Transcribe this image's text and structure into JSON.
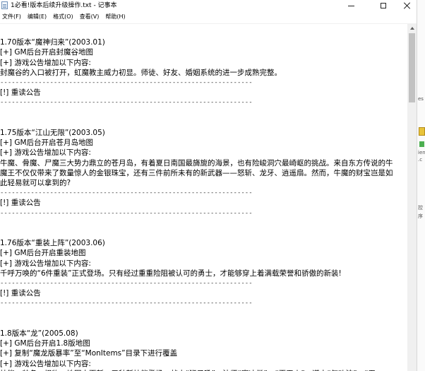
{
  "window": {
    "title": "1必看!版本后续升级操作.txt - 记事本"
  },
  "menu": [
    "文件(F)",
    "编辑(E)",
    "格式(O)",
    "查看(V)",
    "帮助(H)"
  ],
  "lines": [
    "",
    "1.70版本“魔神归来”(2003.01)",
    "[+] GM后台开启封魔谷地图",
    "[+] 游戏公告增加以下内容:",
    "封魔谷的入口被打开，虹魔教主威力初显。师徒、好友、婚姻系统的进一步成熟完整。",
    "------------------------------------------------------------------",
    "[!] 重读公告",
    "------------------------------------------------------------------",
    "",
    "",
    "1.75版本“江山无限”(2003.05)",
    "[+] GM后台开启苍月岛地图",
    "[+] 游戏公告增加以下内容:",
    "牛魔、骨魔、尸魔三大势力鼎立的苍月岛，有着夏日南国最旖旎的海景，也有险峻洞穴最崎岖的挑战。来自东方传说的牛",
    "魔王不仅仅带来了数量惊人的金银珠宝，还有三件前所未有的新武器——怒斩、龙牙、逍遥扇。然而，牛魔的财宝岂是如",
    "此轻易就可以拿到的?",
    "------------------------------------------------------------------",
    "[!] 重读公告",
    "------------------------------------------------------------------",
    "",
    "",
    "1.76版本“重装上阵”(2003.06)",
    "[+] GM后台开启重装地图",
    "[+] 游戏公告增加以下内容:",
    "千呼万唤的“6件重装”正式登场。只有经过重重险阻被认可的勇士，才能够穿上着满载荣誉和骄傲的新装!",
    "------------------------------------------------------------------",
    "[!] 重读公告",
    "------------------------------------------------------------------",
    "",
    "",
    "1.8版本“龙”(2005.08)",
    "[+] GM后台开启1.8版地图",
    "[+] 复制“魔龙版暴率”至“MonItems”目录下进行覆盖",
    "[+] 游戏公告增加以下内容:",
    "技能、装备、怪物、地图大更新，五种新技能登场。战士“狮子吼”、法师“寒冰掌”、“灭天火”、道士“气功波”、“无"
  ],
  "right_peek": [
    "es",
    "ien",
    ".c",
    "控",
    "序"
  ]
}
